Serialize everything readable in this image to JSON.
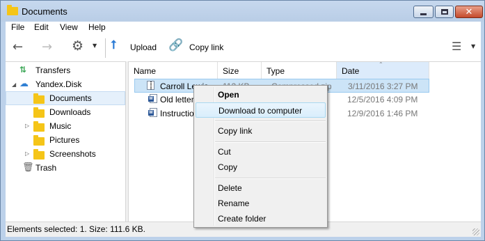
{
  "window": {
    "title": "Documents",
    "buttons": {
      "minimize": "minimize",
      "maximize": "maximize",
      "close": "✕"
    }
  },
  "menubar": [
    "File",
    "Edit",
    "View",
    "Help"
  ],
  "toolbar": {
    "upload_label": "Upload",
    "copy_link_label": "Copy link",
    "accent_color": "#2a7ad5",
    "link_color": "#9b59b6"
  },
  "sidebar": {
    "items": [
      {
        "label": "Transfers",
        "icon": "transfers-icon"
      },
      {
        "label": "Yandex.Disk",
        "icon": "cloud-icon",
        "expanded": true
      },
      {
        "label": "Documents",
        "icon": "folder-icon",
        "selected": true
      },
      {
        "label": "Downloads",
        "icon": "folder-icon"
      },
      {
        "label": "Music",
        "icon": "folder-icon",
        "has_children": true
      },
      {
        "label": "Pictures",
        "icon": "folder-icon"
      },
      {
        "label": "Screenshots",
        "icon": "folder-icon",
        "has_children": true
      },
      {
        "label": "Trash",
        "icon": "trash-icon"
      }
    ]
  },
  "file_list": {
    "columns": [
      "Name",
      "Size",
      "Type",
      "Date"
    ],
    "sorted_column": "Date",
    "rows": [
      {
        "name": "Carroll Lewis",
        "size": "112 KB",
        "type": "Compressed zip",
        "date": "3/11/2016 3:27 PM",
        "icon": "zip-file-icon",
        "selected": true
      },
      {
        "name": "Old letter",
        "size": "",
        "type": "",
        "date": "12/5/2016 4:09 PM",
        "icon": "word-file-icon"
      },
      {
        "name": "Instruction",
        "size": "",
        "type": "",
        "date": "12/9/2016 1:46 PM",
        "icon": "word-file-icon"
      }
    ]
  },
  "context_menu": {
    "items": [
      {
        "label": "Open",
        "bold": true
      },
      {
        "label": "Download to computer",
        "hover": true
      },
      {
        "separator": true
      },
      {
        "label": "Copy link"
      },
      {
        "separator": true
      },
      {
        "label": "Cut"
      },
      {
        "label": "Copy"
      },
      {
        "separator": true
      },
      {
        "label": "Delete"
      },
      {
        "label": "Rename"
      },
      {
        "label": "Create folder"
      }
    ]
  },
  "status_bar": {
    "text": "Elements selected: 1. Size: 111.6 KB."
  }
}
